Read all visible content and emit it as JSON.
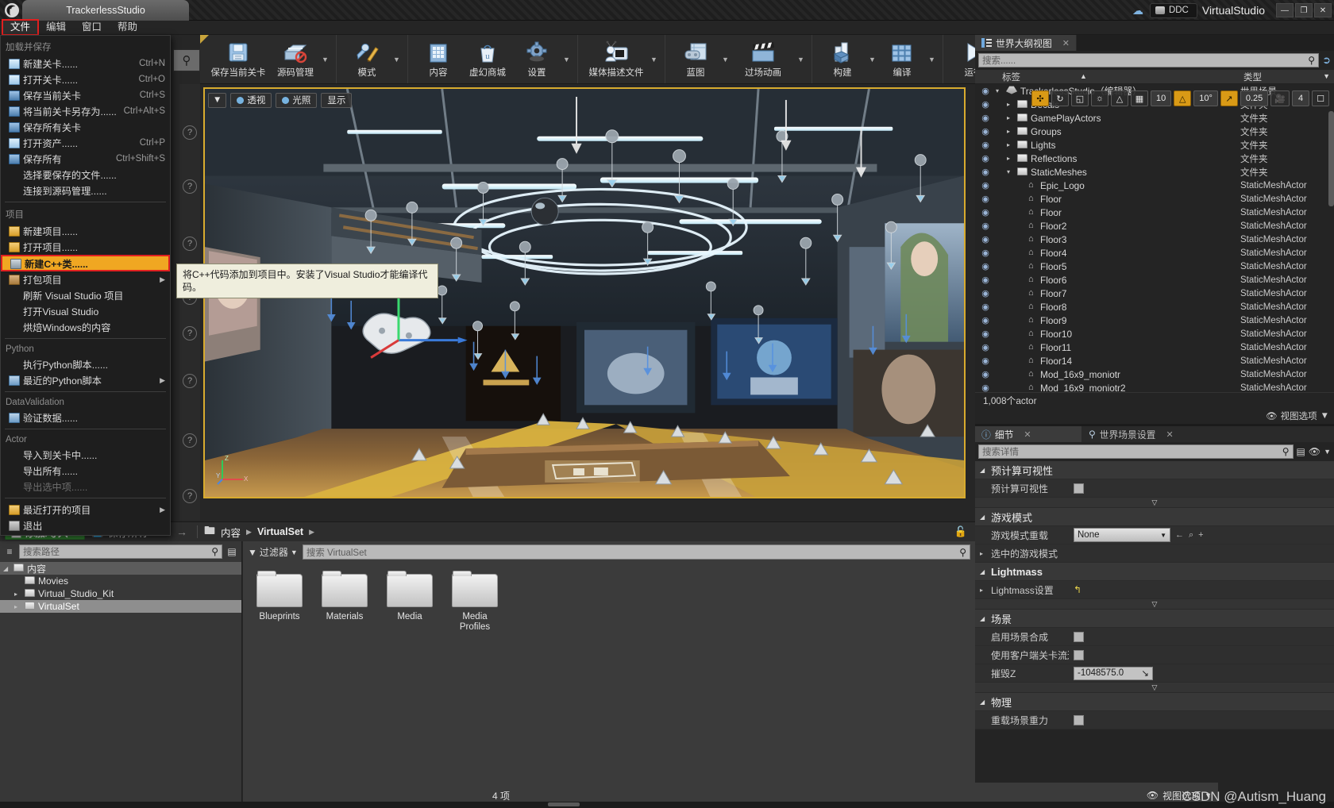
{
  "window": {
    "project_tab": "TrackerlessStudio",
    "ddc_label": "DDC",
    "vs_label": "VirtualStudio",
    "minimize": "—",
    "maximize": "❐",
    "close": "✕"
  },
  "menubar": {
    "items": [
      {
        "label": "文件",
        "active": true
      },
      {
        "label": "编辑",
        "active": false
      },
      {
        "label": "窗口",
        "active": false
      },
      {
        "label": "帮助",
        "active": false
      }
    ]
  },
  "file_menu": {
    "sections": [
      {
        "title": "加载并保存",
        "items": [
          {
            "icon": "new-level-icon",
            "label": "新建关卡......",
            "shortcut": "Ctrl+N"
          },
          {
            "icon": "open-level-icon",
            "label": "打开关卡......",
            "shortcut": "Ctrl+O"
          },
          {
            "icon": "save-level-icon",
            "label": "保存当前关卡",
            "shortcut": "Ctrl+S"
          },
          {
            "icon": "save-as-icon",
            "label": "将当前关卡另存为......",
            "shortcut": "Ctrl+Alt+S"
          },
          {
            "icon": "save-all-levels-icon",
            "label": "保存所有关卡",
            "shortcut": ""
          },
          {
            "icon": "open-asset-icon",
            "label": "打开资产......",
            "shortcut": "Ctrl+P"
          },
          {
            "icon": "save-all-icon",
            "label": "保存所有",
            "shortcut": "Ctrl+Shift+S"
          },
          {
            "icon": "",
            "label": "选择要保存的文件......",
            "shortcut": ""
          },
          {
            "icon": "",
            "label": "连接到源码管理......",
            "shortcut": ""
          }
        ]
      },
      {
        "title": "项目",
        "items": [
          {
            "icon": "new-project-icon",
            "label": "新建项目......",
            "shortcut": ""
          },
          {
            "icon": "open-project-icon",
            "label": "打开项目......",
            "shortcut": ""
          },
          {
            "icon": "new-cpp-class-icon",
            "label": "新建C++类......",
            "shortcut": "",
            "highlighted": true
          },
          {
            "icon": "package-project-icon",
            "label": "打包项目",
            "shortcut": "",
            "submenu": true
          },
          {
            "icon": "",
            "label": "刷新 Visual Studio 项目",
            "shortcut": ""
          },
          {
            "icon": "",
            "label": "打开Visual Studio",
            "shortcut": ""
          },
          {
            "icon": "",
            "label": "烘焙Windows的内容",
            "shortcut": ""
          }
        ]
      },
      {
        "title": "Python",
        "items": [
          {
            "icon": "",
            "label": "执行Python脚本......",
            "shortcut": ""
          },
          {
            "icon": "recent-python-icon",
            "label": "最近的Python脚本",
            "shortcut": "",
            "submenu": true
          }
        ]
      },
      {
        "title": "DataValidation",
        "items": [
          {
            "icon": "validate-data-icon",
            "label": "验证数据......",
            "shortcut": ""
          }
        ]
      },
      {
        "title": "Actor",
        "items": [
          {
            "icon": "",
            "label": "导入到关卡中......",
            "shortcut": ""
          },
          {
            "icon": "",
            "label": "导出所有......",
            "shortcut": ""
          },
          {
            "icon": "",
            "label": "导出选中项......",
            "shortcut": "",
            "disabled": true
          }
        ]
      },
      {
        "title": "",
        "items": [
          {
            "icon": "recent-projects-icon",
            "label": "最近打开的项目",
            "shortcut": "",
            "submenu": true
          },
          {
            "icon": "exit-icon",
            "label": "退出",
            "shortcut": ""
          }
        ]
      }
    ],
    "tooltip": "将C++代码添加到项目中。安装了Visual Studio才能编译代码。"
  },
  "toolbar": {
    "groups": [
      {
        "buttons": [
          {
            "icon": "floppy-disk-icon",
            "label": "保存当前关卡",
            "caret": false
          },
          {
            "icon": "source-control-icon",
            "label": "源码管理",
            "caret": true
          }
        ]
      },
      {
        "buttons": [
          {
            "icon": "wrench-pencil-icon",
            "label": "模式",
            "caret": true
          }
        ]
      },
      {
        "buttons": [
          {
            "icon": "content-icon",
            "label": "内容",
            "caret": false
          },
          {
            "icon": "marketplace-bag-icon",
            "label": "虚幻商城",
            "caret": false
          },
          {
            "icon": "gear-icon",
            "label": "设置",
            "caret": true
          }
        ]
      },
      {
        "buttons": [
          {
            "icon": "media-profile-icon",
            "label": "媒体描述文件",
            "caret": true
          }
        ]
      },
      {
        "buttons": [
          {
            "icon": "blueprint-icon",
            "label": "蓝图",
            "caret": true
          },
          {
            "icon": "clapperboard-icon",
            "label": "过场动画",
            "caret": true
          }
        ]
      },
      {
        "buttons": [
          {
            "icon": "build-icon",
            "label": "构建",
            "caret": true
          },
          {
            "icon": "compile-icon",
            "label": "编译",
            "caret": true
          }
        ]
      },
      {
        "buttons": [
          {
            "icon": "play-icon",
            "label": "运行",
            "caret": true
          }
        ]
      }
    ],
    "overflow": "»"
  },
  "viewport": {
    "buttons": [
      {
        "icon": "perspective-icon",
        "label": "透视"
      },
      {
        "icon": "lighting-icon",
        "label": "光照"
      },
      {
        "icon": "show-icon",
        "label": "显示"
      }
    ],
    "right_controls": [
      {
        "name": "transform-coords-icon",
        "value": ""
      },
      {
        "name": "rotate-snap-toggle-icon",
        "value": ""
      },
      {
        "name": "surface-snap-icon",
        "value": ""
      },
      {
        "name": "world-axis-icon",
        "value": ""
      },
      {
        "name": "scale-snap-icon",
        "value": ""
      }
    ],
    "grid_snap": "10",
    "rotation_snap": "10°",
    "scale_snap": "0.25",
    "camera_speed": "4",
    "axis_labels": {
      "x": "X",
      "y": "Y",
      "z": "Z"
    }
  },
  "world_outliner": {
    "tab_label": "世界大纲视图",
    "search_placeholder": "搜索......",
    "columns": {
      "label": "标签",
      "type": "类型"
    },
    "rows": [
      {
        "name": "TrackerlessStudio（编辑器）",
        "type": "世界场景",
        "icon": "ue-world-icon",
        "depth": 0,
        "expanded": true
      },
      {
        "name": "Decals",
        "type": "文件夹",
        "icon": "folder-icon",
        "depth": 1,
        "collapsed": true
      },
      {
        "name": "GamePlayActors",
        "type": "文件夹",
        "icon": "folder-icon",
        "depth": 1,
        "collapsed": true
      },
      {
        "name": "Groups",
        "type": "文件夹",
        "icon": "folder-icon",
        "depth": 1,
        "collapsed": true
      },
      {
        "name": "Lights",
        "type": "文件夹",
        "icon": "folder-icon",
        "depth": 1,
        "collapsed": true
      },
      {
        "name": "Reflections",
        "type": "文件夹",
        "icon": "folder-icon",
        "depth": 1,
        "collapsed": true
      },
      {
        "name": "StaticMeshes",
        "type": "文件夹",
        "icon": "folder-open-icon",
        "depth": 1,
        "expanded": true
      },
      {
        "name": "Epic_Logo",
        "type": "StaticMeshActor",
        "icon": "mesh-icon",
        "depth": 2
      },
      {
        "name": "Floor",
        "type": "StaticMeshActor",
        "icon": "mesh-icon",
        "depth": 2
      },
      {
        "name": "Floor",
        "type": "StaticMeshActor",
        "icon": "mesh-icon",
        "depth": 2
      },
      {
        "name": "Floor2",
        "type": "StaticMeshActor",
        "icon": "mesh-icon",
        "depth": 2
      },
      {
        "name": "Floor3",
        "type": "StaticMeshActor",
        "icon": "mesh-icon",
        "depth": 2
      },
      {
        "name": "Floor4",
        "type": "StaticMeshActor",
        "icon": "mesh-icon",
        "depth": 2
      },
      {
        "name": "Floor5",
        "type": "StaticMeshActor",
        "icon": "mesh-icon",
        "depth": 2
      },
      {
        "name": "Floor6",
        "type": "StaticMeshActor",
        "icon": "mesh-icon",
        "depth": 2
      },
      {
        "name": "Floor7",
        "type": "StaticMeshActor",
        "icon": "mesh-icon",
        "depth": 2
      },
      {
        "name": "Floor8",
        "type": "StaticMeshActor",
        "icon": "mesh-icon",
        "depth": 2
      },
      {
        "name": "Floor9",
        "type": "StaticMeshActor",
        "icon": "mesh-icon",
        "depth": 2
      },
      {
        "name": "Floor10",
        "type": "StaticMeshActor",
        "icon": "mesh-icon",
        "depth": 2
      },
      {
        "name": "Floor11",
        "type": "StaticMeshActor",
        "icon": "mesh-icon",
        "depth": 2
      },
      {
        "name": "Floor14",
        "type": "StaticMeshActor",
        "icon": "mesh-icon",
        "depth": 2
      },
      {
        "name": "Mod_16x9_moniotr",
        "type": "StaticMeshActor",
        "icon": "mesh-icon",
        "depth": 2
      },
      {
        "name": "Mod_16x9_moniotr2",
        "type": "StaticMeshActor",
        "icon": "mesh-icon",
        "depth": 2
      }
    ],
    "actor_count": "1,008个actor",
    "view_options": "视图选项"
  },
  "details": {
    "tabs": [
      {
        "label": "细节",
        "icon": "info-icon",
        "active": true,
        "closable": true
      },
      {
        "label": "世界场景设置",
        "icon": "world-settings-icon",
        "active": false,
        "closable": true
      }
    ],
    "search_placeholder": "搜索详情",
    "categories": [
      {
        "title": "预计算可视性",
        "bold": false,
        "props": [
          {
            "key": "预计算可视性",
            "type": "checkbox",
            "value": false
          }
        ],
        "expander": true
      },
      {
        "title": "游戏模式",
        "bold": false,
        "props": [
          {
            "key": "游戏模式重载",
            "type": "select",
            "value": "None"
          },
          {
            "key": "选中的游戏模式",
            "type": "tri",
            "value": ""
          }
        ],
        "expander": false
      },
      {
        "title": "Lightmass",
        "bold": true,
        "props": [
          {
            "key": "Lightmass设置",
            "type": "reset",
            "value": ""
          }
        ],
        "expander": true
      },
      {
        "title": "场景",
        "bold": false,
        "props": [
          {
            "key": "启用场景合成",
            "type": "checkbox",
            "value": false
          },
          {
            "key": "使用客户端关卡流送体积",
            "type": "checkbox",
            "value": false
          },
          {
            "key": "摧毁Z",
            "type": "text",
            "value": "-1048575.0"
          }
        ],
        "expander": true
      },
      {
        "title": "物理",
        "bold": false,
        "props": [
          {
            "key": "重载场景重力",
            "type": "checkbox",
            "value": false
          }
        ],
        "expander": false
      }
    ]
  },
  "content_browser": {
    "add_import_label": "添加/导入",
    "save_all_label": "保存所有",
    "breadcrumb": [
      "内容",
      "VirtualSet"
    ],
    "path_search_placeholder": "搜索路径",
    "filter_label": "过滤器",
    "asset_search_placeholder": "搜索 VirtualSet",
    "tree": [
      {
        "label": "内容",
        "depth": 0,
        "expanded": true,
        "selected": false,
        "root": true
      },
      {
        "label": "Movies",
        "depth": 1,
        "expanded": false,
        "selected": false
      },
      {
        "label": "Virtual_Studio_Kit",
        "depth": 1,
        "collapsed": true,
        "selected": false
      },
      {
        "label": "VirtualSet",
        "depth": 1,
        "collapsed": true,
        "selected": true
      }
    ],
    "assets": [
      {
        "name": "Blueprints",
        "icon": "folder-icon"
      },
      {
        "name": "Materials",
        "icon": "folder-icon"
      },
      {
        "name": "Media",
        "icon": "folder-icon"
      },
      {
        "name": "Media\nProfiles",
        "icon": "folder-icon"
      }
    ],
    "item_count": "4 项",
    "view_options": "视图选项"
  },
  "watermark": "CSDN @Autism_Huang"
}
